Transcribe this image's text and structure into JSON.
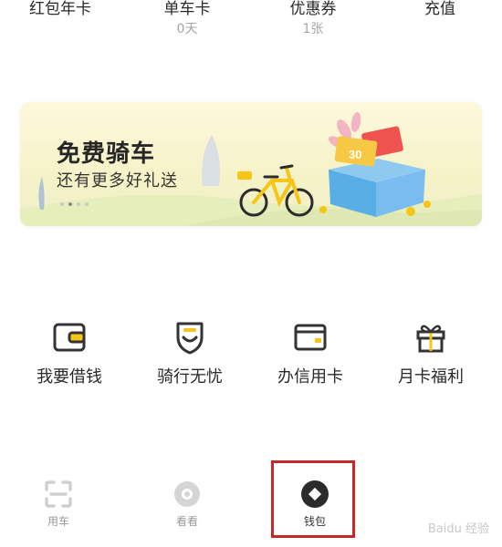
{
  "stats": [
    {
      "label": "红包年卡",
      "value": ""
    },
    {
      "label": "单车卡",
      "value": "0天"
    },
    {
      "label": "优惠券",
      "value": "1张"
    },
    {
      "label": "充值",
      "value": ""
    }
  ],
  "banner": {
    "title": "免费骑车",
    "subtitle": "还有更多好礼送",
    "coupon_text": "30",
    "page_count": 4,
    "active_page": 1
  },
  "features": [
    {
      "label": "我要借钱",
      "icon": "wallet-icon"
    },
    {
      "label": "骑行无忧",
      "icon": "shield-icon"
    },
    {
      "label": "办信用卡",
      "icon": "credit-card-icon"
    },
    {
      "label": "月卡福利",
      "icon": "gift-icon"
    }
  ],
  "nav": [
    {
      "label": "用车",
      "icon": "scan-icon",
      "active": false
    },
    {
      "label": "看看",
      "icon": "eye-icon",
      "active": false
    },
    {
      "label": "钱包",
      "icon": "wallet-coin-icon",
      "active": true
    }
  ],
  "watermark": "Baidu 经验",
  "colors": {
    "accent_yellow": "#f5c518",
    "highlight_red": "#c62828",
    "icon_gray": "#d5d5d5",
    "text_dark": "#2a2a2a"
  }
}
